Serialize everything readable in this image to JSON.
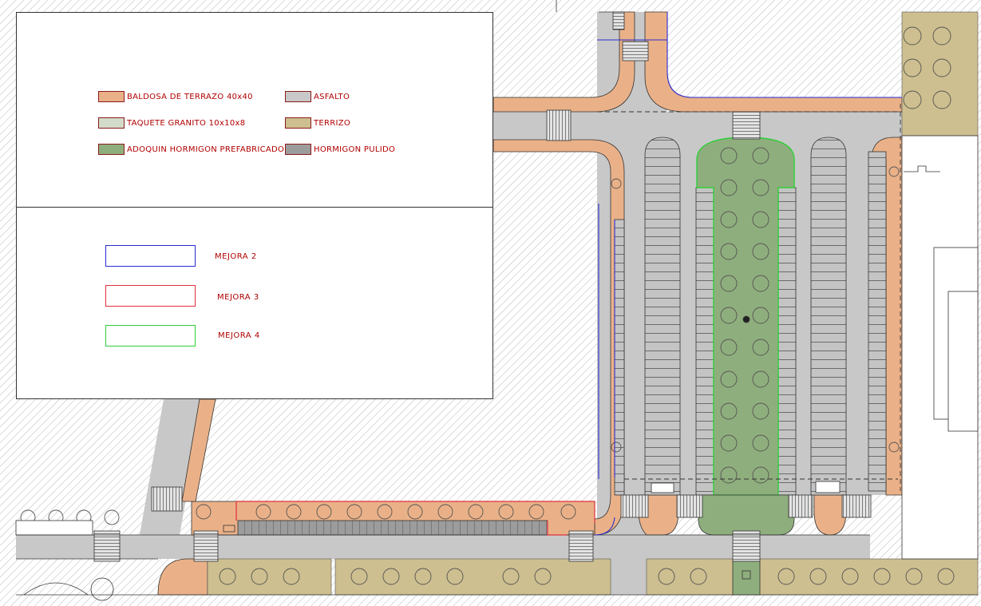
{
  "colors": {
    "baldosa": "#eab188",
    "taquete": "#d3dccb",
    "adoquin": "#8fae7d",
    "asfalto": "#c8c8c8",
    "terrizo": "#cdbf8f",
    "hormigon": "#9c9c9c",
    "mejora2": "#2b2bd0",
    "mejora3": "#e0303a",
    "mejora4": "#2fcf3a",
    "text": "#b00000"
  },
  "legend": {
    "materials": [
      {
        "label": "BALDOSA DE TERRAZO 40x40",
        "color_key": "baldosa"
      },
      {
        "label": "TAQUETE GRANITO 10x10x8",
        "color_key": "taquete"
      },
      {
        "label": "ADOQUIN HORMIGON PREFABRICADO",
        "color_key": "adoquin"
      },
      {
        "label": "ASFALTO",
        "color_key": "asfalto"
      },
      {
        "label": "TERRIZO",
        "color_key": "terrizo"
      },
      {
        "label": "HORMIGON PULIDO",
        "color_key": "hormigon"
      }
    ],
    "improvements": [
      {
        "label": "MEJORA 2",
        "color_key": "mejora2"
      },
      {
        "label": "MEJORA 3",
        "color_key": "mejora3"
      },
      {
        "label": "MEJORA 4",
        "color_key": "mejora4"
      }
    ]
  }
}
